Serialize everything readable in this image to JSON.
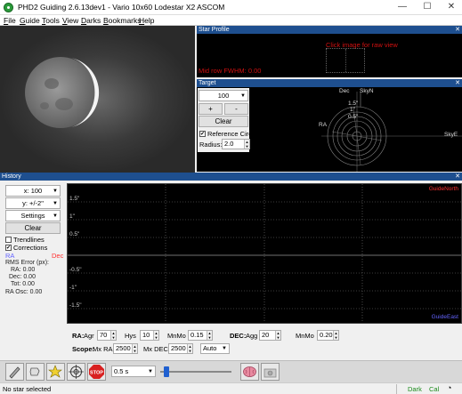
{
  "window": {
    "title": "PHD2 Guiding 2.6.13dev1 - Vario 10x60 Lodestar X2 ASCOM",
    "minimize": "—",
    "maximize": "☐",
    "close": "✕"
  },
  "menu": [
    {
      "accel": "F",
      "rest": "ile"
    },
    {
      "accel": "G",
      "rest": "uide"
    },
    {
      "accel": "T",
      "rest": "ools"
    },
    {
      "accel": "V",
      "rest": "iew"
    },
    {
      "accel": "D",
      "rest": "arks"
    },
    {
      "accel": "B",
      "rest": "ookmarks"
    },
    {
      "accel": "H",
      "rest": "elp"
    }
  ],
  "star_profile": {
    "title": "Star Profile",
    "close": "✕",
    "click_msg": "Click image for raw view",
    "fwhm": "Mid row FWHM: 0.00"
  },
  "target": {
    "title": "Target",
    "close": "✕",
    "zoom_value": "100",
    "plus": "+",
    "minus": "-",
    "clear": "Clear",
    "ref_circle_label": "Reference Circle",
    "ref_circle_checked": "✔",
    "radius_label": "Radius:",
    "radius_value": "2.0",
    "axis_dec": "Dec",
    "axis_skyn": "SkyN",
    "axis_ra": "RA",
    "axis_skye": "SkyE",
    "ring_labels": [
      "1.5\"",
      "1\"",
      "0.5\""
    ]
  },
  "history": {
    "title": "History",
    "close": "✕",
    "x_scale": "x: 100",
    "y_scale": "y: +/-2\"",
    "settings": "Settings",
    "clear": "Clear",
    "trendlines": "Trendlines",
    "corrections": "Corrections",
    "corrections_checked": "✔",
    "legend_ra": "RA",
    "legend_dec": "Dec",
    "rms_title": "RMS Error (px):",
    "rms_ra": "RA: 0.00",
    "rms_dec": "Dec: 0.00",
    "rms_tot": "Tot: 0.00",
    "ra_osc": "RA Osc: 0.00",
    "y_ticks": [
      "1.5\"",
      "1\"",
      "0.5\"",
      "-0.5\"",
      "-1\"",
      "-1.5\""
    ],
    "guide_north": "GuideNorth",
    "guide_east": "GuideEast",
    "colors": {
      "ra": "#6464ff",
      "dec": "#ff3030",
      "guide_north": "#ff3030",
      "guide_east": "#6464ff"
    }
  },
  "params": {
    "ra_label": "RA:",
    "agr_label": "Agr",
    "agr_value": "70",
    "hys_label": "Hys",
    "hys_value": "10",
    "mnmo_ra_label": "MnMo",
    "mnmo_ra_value": "0.15",
    "dec_label": "DEC:",
    "agg_label": "Agg",
    "agg_value": "20",
    "mnmo_dec_label": "MnMo",
    "mnmo_dec_value": "0.20",
    "scope_label": "Scope:",
    "mx_ra_label": "Mx RA",
    "mx_ra_value": "2500",
    "mx_dec_label": "Mx DEC",
    "mx_dec_value": "2500",
    "dec_mode": "Auto"
  },
  "toolbar": {
    "exposure": "0.5 s",
    "stop": "STOP"
  },
  "status": {
    "message": "No star selected",
    "dark": "Dark",
    "cal": "Cal",
    "dark_color": "#1a8a1a",
    "cal_color": "#1a8a1a"
  }
}
